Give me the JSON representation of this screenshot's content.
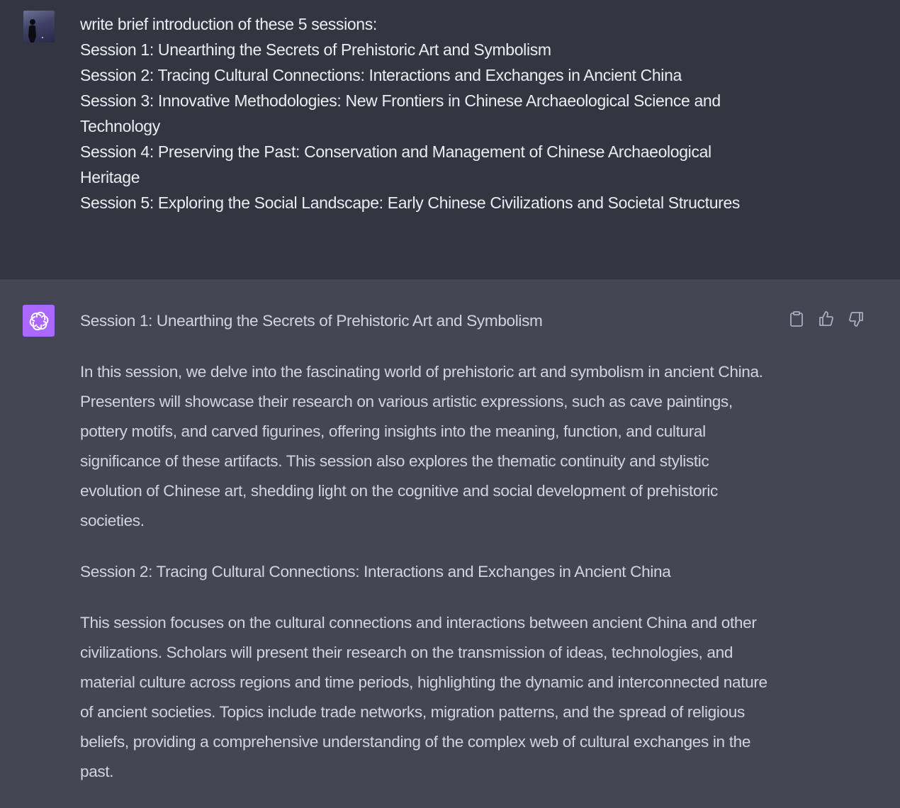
{
  "user_message": {
    "lines": [
      "write brief introduction of these 5 sessions:",
      "Session 1: Unearthing the Secrets of Prehistoric Art and Symbolism",
      "Session 2: Tracing Cultural Connections: Interactions and Exchanges in Ancient China",
      "Session 3: Innovative Methodologies: New Frontiers in Chinese Archaeological Science and Technology",
      "Session 4: Preserving the Past: Conservation and Management of Chinese Archaeological Heritage",
      "Session 5: Exploring the Social Landscape: Early Chinese Civilizations and Societal Structures"
    ]
  },
  "assistant_message": {
    "paragraphs": [
      "Session 1: Unearthing the Secrets of Prehistoric Art and Symbolism",
      "In this session, we delve into the fascinating world of prehistoric art and symbolism in ancient China. Presenters will showcase their research on various artistic expressions, such as cave paintings, pottery motifs, and carved figurines, offering insights into the meaning, function, and cultural significance of these artifacts. This session also explores the thematic continuity and stylistic evolution of Chinese art, shedding light on the cognitive and social development of prehistoric societies.",
      "Session 2: Tracing Cultural Connections: Interactions and Exchanges in Ancient China",
      "This session focuses on the cultural connections and interactions between ancient China and other civilizations. Scholars will present their research on the transmission of ideas, technologies, and material culture across regions and time periods, highlighting the dynamic and interconnected nature of ancient societies. Topics include trade networks, migration patterns, and the spread of religious beliefs, providing a comprehensive understanding of the complex web of cultural exchanges in the past."
    ],
    "actions": {
      "copy_icon": "clipboard-icon",
      "like_icon": "thumbs-up-icon",
      "dislike_icon": "thumbs-down-icon"
    }
  },
  "colors": {
    "user_bg": "#343541",
    "assistant_bg": "#444654",
    "assistant_avatar": "#ab68ff",
    "user_text": "#ececf1",
    "assistant_text": "#d1d5db"
  }
}
